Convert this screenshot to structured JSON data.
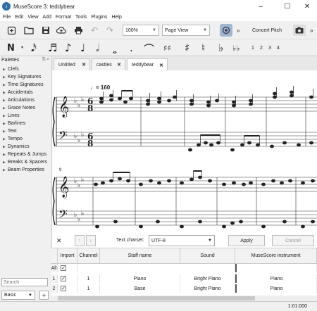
{
  "window": {
    "title": "MuseScore 3: teddybear",
    "min": "–",
    "max": "☐",
    "close": "✕"
  },
  "menu": [
    "File",
    "Edit",
    "View",
    "Add",
    "Format",
    "Tools",
    "Plugins",
    "Help"
  ],
  "toolbar": {
    "zoom": "100%",
    "view_mode": "Page View",
    "concert_pitch": "Concert Pitch",
    "overflow": "»"
  },
  "note_input": {
    "mode_icon": "N",
    "durations": [
      "𝅘𝅥𝅯",
      "𝅘𝅥𝅮",
      "♪",
      "♩",
      "𝅗𝅥",
      "𝅝",
      "."
    ],
    "accidentals": [
      "♯♯",
      "♯",
      "♮",
      "♭",
      "♭♭"
    ],
    "voices": [
      "1",
      "2",
      "3",
      "4"
    ]
  },
  "palettes": {
    "header": "Palettes",
    "controls": "⎘ ×",
    "items": [
      "Clefs",
      "Key Signatures",
      "Time Signatures",
      "Accidentals",
      "Articulations",
      "Grace Notes",
      "Lines",
      "Barlines",
      "Text",
      "Tempo",
      "Dynamics",
      "Repeats & Jumps",
      "Breaks & Spacers",
      "Beam Properties"
    ],
    "search_placeholder": "Search",
    "workspace": "Basic",
    "add": "+"
  },
  "tabs": [
    {
      "label": "Untitled",
      "close": "✕"
    },
    {
      "label": "castles",
      "close": "✕"
    },
    {
      "label": "teddybear",
      "close": "✕"
    }
  ],
  "score": {
    "tempo": "♩= 160",
    "time_sig_top": "6",
    "time_sig_bottom": "8",
    "measure_number": "9"
  },
  "import_panel": {
    "close": "✕",
    "up": "↑",
    "down": "↓",
    "charset_label": "Text charset:",
    "charset_value": "UTF-8",
    "apply": "Apply",
    "cancel": "Cancel",
    "columns": [
      "Import",
      "Channel",
      "Staff name",
      "Sound",
      "MuseScore instrument"
    ],
    "all_label": "All",
    "rows": [
      {
        "num": "1",
        "channel": "1",
        "staff": "Piano",
        "sound": "Bright Piano",
        "instrument": "Piano"
      },
      {
        "num": "2",
        "channel": "1",
        "staff": "Base",
        "sound": "Bright Piano",
        "instrument": "Piano"
      }
    ]
  },
  "status": {
    "time": "1:01:000"
  }
}
